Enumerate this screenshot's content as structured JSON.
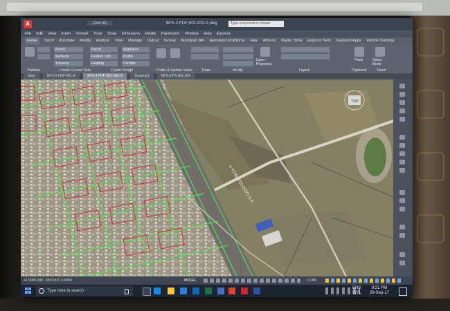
{
  "app": {
    "logo": "A",
    "file_title": "BFS-2-FDP-001-003-A.dwg",
    "search_placeholder": "Type a keyword or phrase",
    "doc_tab": "Civil 3D"
  },
  "menubar": {
    "items": [
      "File",
      "Edit",
      "View",
      "Insert",
      "Format",
      "Tools",
      "Draw",
      "Dimension",
      "Modify",
      "Parametric",
      "Window",
      "Help",
      "Express"
    ]
  },
  "ribbon_tabs": {
    "items": [
      "Home",
      "Insert",
      "Annotate",
      "Modify",
      "Analyze",
      "View",
      "Manage",
      "Output",
      "Survey",
      "Autodesk 360",
      "Autodesk InfraWorks",
      "Help",
      "Add-ins",
      "Raster Tools",
      "Express Tools",
      "Featured Apps",
      "Vehicle Tracking"
    ],
    "active": "Home"
  },
  "ribbon": {
    "panels": [
      "Palettes",
      "Create Ground Data",
      "Create Design",
      "Profile & Section Views",
      "Draw",
      "Modify",
      "Layers",
      "Clipboard",
      "Touch"
    ],
    "buttons": {
      "parcel": "Parcel",
      "feature_line": "Feature Line",
      "grading": "Grading",
      "alignment": "Alignment",
      "profile": "Profile",
      "corridor": "Corridor",
      "surfaces": "Surfaces",
      "points": "Points",
      "traverse": "Traverse",
      "layer_properties": "Layer Properties",
      "paste": "Paste",
      "select_mode": "Select Mode"
    }
  },
  "file_tabs": {
    "items": [
      "Start",
      "BFS-2-FDP-001-A",
      "BFS-2-FDP-001-003-A",
      "Drawing1",
      "BFS-2-FS-001-004"
    ],
    "active": "BFS-2-FDP-001-003-A"
  },
  "map": {
    "watermark": "© KTIMATOLOGIO S.A.",
    "viewcube_label": "TOP"
  },
  "status": {
    "coords": "+1.5000.000, 1000.000, 0.0000",
    "model": "MODEL",
    "scale": "1:1000"
  },
  "taskbar": {
    "search_text": "Type here to search",
    "lang": "ENG",
    "lang2": "INTL",
    "time": "9:21 PM",
    "date": "29-Sep-17"
  },
  "colors": {
    "parcel_red": "#c9333d",
    "road_green": "#5fd35a",
    "ribbon_bg": "#5d646f",
    "taskbar_bg": "#1c2331"
  }
}
